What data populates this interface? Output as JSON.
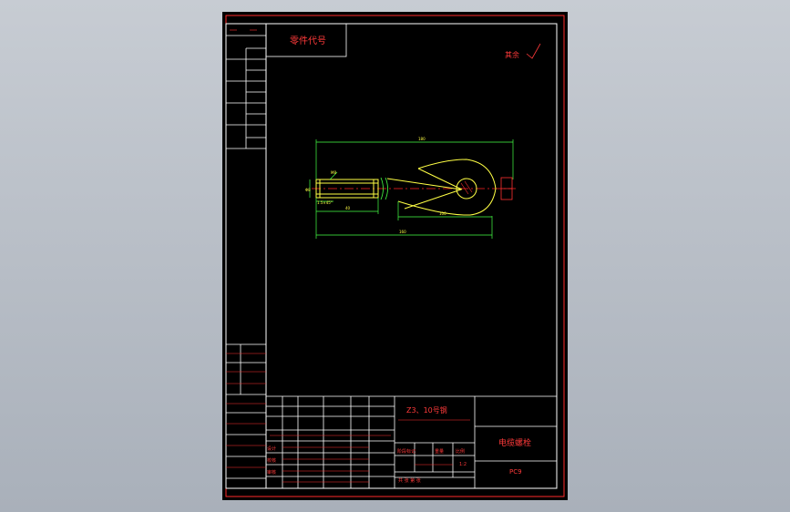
{
  "drawing": {
    "part_code_label": "零件代号",
    "roughness_label": "其余",
    "material": "Z3、10号钢",
    "part_name": "电缆螺栓",
    "drawing_number": "PC9",
    "dimensions": {
      "overall_top": "180",
      "overall_bottom": "160",
      "shank_length": "40",
      "eye_length": "100",
      "thread": "M8",
      "diameter": "Φ8",
      "chamfer": "1.5×45°"
    },
    "title_block": {
      "row_labels": [
        "设计",
        "校核",
        "审核"
      ],
      "mark_labels": [
        "阶段标记",
        "重量",
        "比例"
      ],
      "scale": "1:2",
      "sheet_info": "共 张 第 张"
    }
  }
}
